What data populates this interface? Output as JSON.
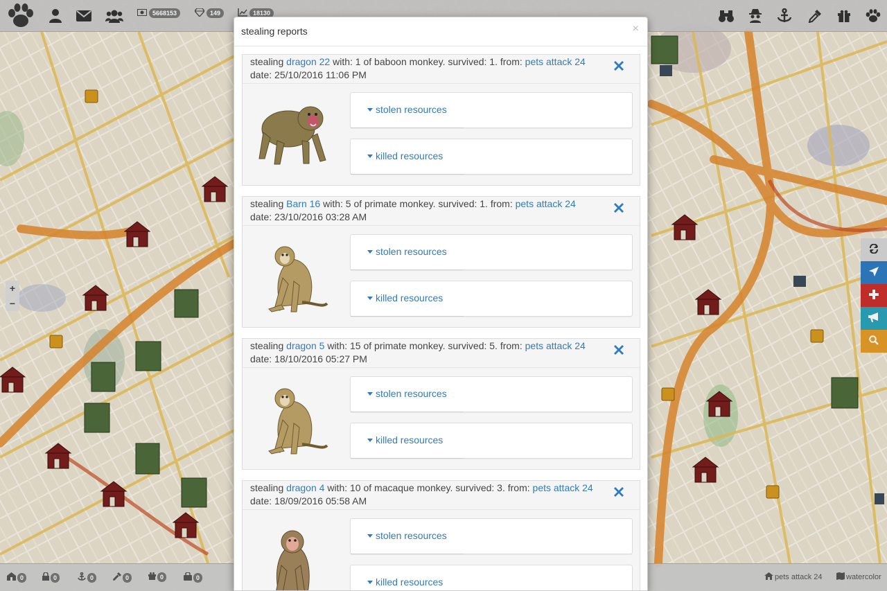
{
  "topbar": {
    "stats": [
      {
        "icon": "money-icon",
        "value": "5668153"
      },
      {
        "icon": "diamond-icon",
        "value": "149"
      },
      {
        "icon": "chart-icon",
        "value": "18130"
      }
    ],
    "left_icons": [
      "paw-logo-icon",
      "user-icon",
      "envelope-icon",
      "users-icon"
    ],
    "right_icons": [
      "binoculars-icon",
      "spy-icon",
      "anchor-icon",
      "eyedropper-icon",
      "gift-icon",
      "paw-icon"
    ]
  },
  "bottombar": {
    "counters": [
      {
        "icon": "barn-icon",
        "value": "0"
      },
      {
        "icon": "lock-icon",
        "value": "0"
      },
      {
        "icon": "anchor-icon",
        "value": "0"
      },
      {
        "icon": "dropper-icon",
        "value": "0"
      },
      {
        "icon": "gift-icon",
        "value": "0"
      },
      {
        "icon": "bag-icon",
        "value": "0"
      }
    ],
    "location_label": "pets attack 24",
    "map_style_label": "watercolor"
  },
  "zoom": {
    "in": "+",
    "out": "−"
  },
  "side_buttons": [
    {
      "icon": "refresh-icon",
      "color": "#d5d5d5"
    },
    {
      "icon": "location-arrow-icon",
      "color": "#2e7bbf"
    },
    {
      "icon": "plus-icon",
      "color": "#c9302c"
    },
    {
      "icon": "bullhorn-icon",
      "color": "#2aa3b9"
    },
    {
      "icon": "search-icon",
      "color": "#e49b2a"
    }
  ],
  "modal": {
    "title": "stealing reports",
    "close": "×",
    "stolen_label": "stolen resources",
    "killed_label": "killed resources",
    "reports": [
      {
        "prefix": "stealing",
        "target": "dragon 22",
        "details": "with: 1 of baboon monkey. survived: 1. from:",
        "source": "pets attack 24",
        "date": "date: 25/10/2016 11:06 PM",
        "animal": "baboon"
      },
      {
        "prefix": "stealing",
        "target": "Barn 16",
        "details": "with: 5 of primate monkey. survived: 1. from:",
        "source": "pets attack 24",
        "date": "date: 23/10/2016 03:28 AM",
        "animal": "primate"
      },
      {
        "prefix": "stealing",
        "target": "dragon 5",
        "details": "with: 15 of primate monkey. survived: 5. from:",
        "source": "pets attack 24",
        "date": "date: 18/10/2016 05:27 PM",
        "animal": "primate"
      },
      {
        "prefix": "stealing",
        "target": "dragon 4",
        "details": "with: 10 of macaque monkey. survived: 3. from:",
        "source": "pets attack 24",
        "date": "date: 18/09/2016 05:58 AM",
        "animal": "macaque"
      }
    ]
  }
}
